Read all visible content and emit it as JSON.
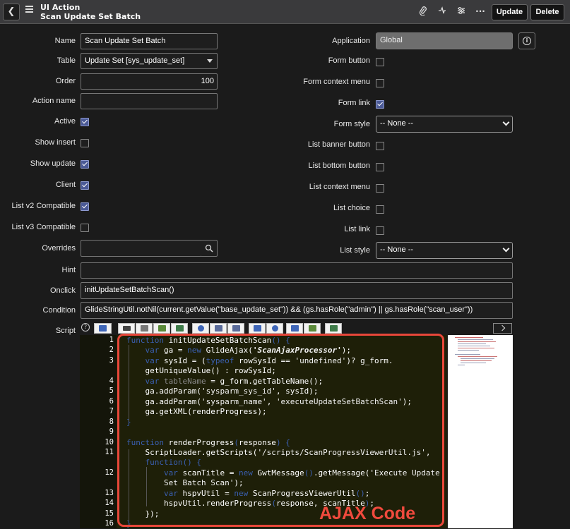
{
  "header": {
    "title": "UI Action",
    "subtitle": "Scan Update Set Batch",
    "update_label": "Update",
    "delete_label": "Delete",
    "icons": [
      "chevron-left-icon",
      "hamburger-menu-icon",
      "paperclip-icon",
      "activity-icon",
      "settings-sliders-icon",
      "more-icon"
    ]
  },
  "form": {
    "name": {
      "label": "Name",
      "value": "Scan Update Set Batch"
    },
    "table": {
      "label": "Table",
      "value": "Update Set [sys_update_set]"
    },
    "order": {
      "label": "Order",
      "value": "100"
    },
    "action_name": {
      "label": "Action name",
      "value": ""
    },
    "active": {
      "label": "Active",
      "checked": true
    },
    "show_insert": {
      "label": "Show insert",
      "checked": false
    },
    "show_update": {
      "label": "Show update",
      "checked": true
    },
    "client": {
      "label": "Client",
      "checked": true
    },
    "list_v2": {
      "label": "List v2 Compatible",
      "checked": true
    },
    "list_v3": {
      "label": "List v3 Compatible",
      "checked": false
    },
    "overrides": {
      "label": "Overrides",
      "value": ""
    },
    "application": {
      "label": "Application",
      "value": "Global"
    },
    "form_button": {
      "label": "Form button",
      "checked": false
    },
    "form_context_menu": {
      "label": "Form context menu",
      "checked": false
    },
    "form_link": {
      "label": "Form link",
      "checked": true
    },
    "form_style": {
      "label": "Form style",
      "value": "-- None --"
    },
    "list_banner_button": {
      "label": "List banner button",
      "checked": false
    },
    "list_bottom_button": {
      "label": "List bottom button",
      "checked": false
    },
    "list_context_menu": {
      "label": "List context menu",
      "checked": false
    },
    "list_choice": {
      "label": "List choice",
      "checked": false
    },
    "list_link": {
      "label": "List link",
      "checked": false
    },
    "list_style": {
      "label": "List style",
      "value": "-- None --"
    },
    "hint": {
      "label": "Hint",
      "value": ""
    },
    "onclick": {
      "label": "Onclick",
      "value": "initUpdateSetBatchScan()"
    },
    "condition": {
      "label": "Condition",
      "value": "GlideStringUtil.notNil(current.getValue(\"base_update_set\")) && (gs.hasRole(\"admin\") || gs.hasRole(\"scan_user\"))"
    },
    "script": {
      "label": "Script"
    }
  },
  "script": {
    "line_numbers": [
      "1",
      "2",
      "3",
      "",
      "4",
      "5",
      "6",
      "7",
      "8",
      "9",
      "10",
      "11",
      "",
      "12",
      "",
      "13",
      "14",
      "15",
      "16"
    ],
    "lines": [
      [
        "kw:function",
        "t: initUpdateSetBatchScan",
        "kw:()",
        "t: ",
        "kw:{"
      ],
      [
        "t:    ",
        "kw:var",
        "t: ga = ",
        "kw:new",
        "t: GlideAjax(",
        "si:'ScanAjaxProcessor'",
        "t:);"
      ],
      [
        "t:    ",
        "kw:var",
        "t: sysId = (",
        "kw:typeof",
        "t: rowSysId == ",
        "s:'undefined'",
        "t:)? g_form."
      ],
      [
        "t:    getUniqueValue() : rowSysId;"
      ],
      [
        "t:    ",
        "kw:var",
        "f: tableName",
        "t: = g_form.getTableName();"
      ],
      [
        "t:    ga.addParam(",
        "s:'sysparm_sys_id'",
        "t:, sysId);"
      ],
      [
        "t:    ga.addParam(",
        "s:'sysparm_name'",
        "t:, ",
        "s:'executeUpdateSetBatchScan'",
        "t:);"
      ],
      [
        "t:    ga.getXML(renderProgress);"
      ],
      [
        "kw:}"
      ],
      [
        "t:"
      ],
      [
        "kw:function",
        "t: renderProgress",
        "kw:(",
        "t:response",
        "kw:)",
        "t: ",
        "kw:{"
      ],
      [
        "t:    ScriptLoader.getScripts(",
        "s:'/scripts/ScanProgressViewerUtil.js'",
        "t:,"
      ],
      [
        "t:    ",
        "kw:function",
        "kw:()",
        "t: ",
        "kw:{"
      ],
      [
        "t:        ",
        "kw:var",
        "t: scanTitle = ",
        "kw:new",
        "t: GwtMessage",
        "kw:()",
        "t:.getMessage(",
        "s:'Execute Update"
      ],
      [
        "t:        ",
        "s:Set Batch Scan'",
        "t:);"
      ],
      [
        "t:        ",
        "kw:var",
        "t: hspvUtil = ",
        "kw:new",
        "t: ScanProgressViewerUtil",
        "kw:()",
        "t:;"
      ],
      [
        "t:        hspvUtil.renderProgress",
        "kw:(",
        "t:response, scanTitle",
        "kw:)",
        "t:;"
      ],
      [
        "t:    });"
      ],
      [
        "kw:}"
      ]
    ],
    "annotation": "AJAX Code"
  }
}
